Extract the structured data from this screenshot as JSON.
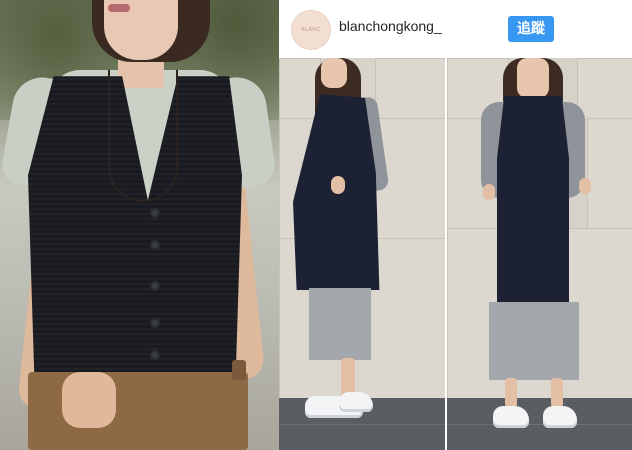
{
  "profile": {
    "username": "blanchongkong_",
    "avatar_text": "BLANC",
    "follow_label": "追蹤",
    "follow_color": "#3897f0"
  },
  "icons": {
    "avatar": "avatar-logo"
  }
}
